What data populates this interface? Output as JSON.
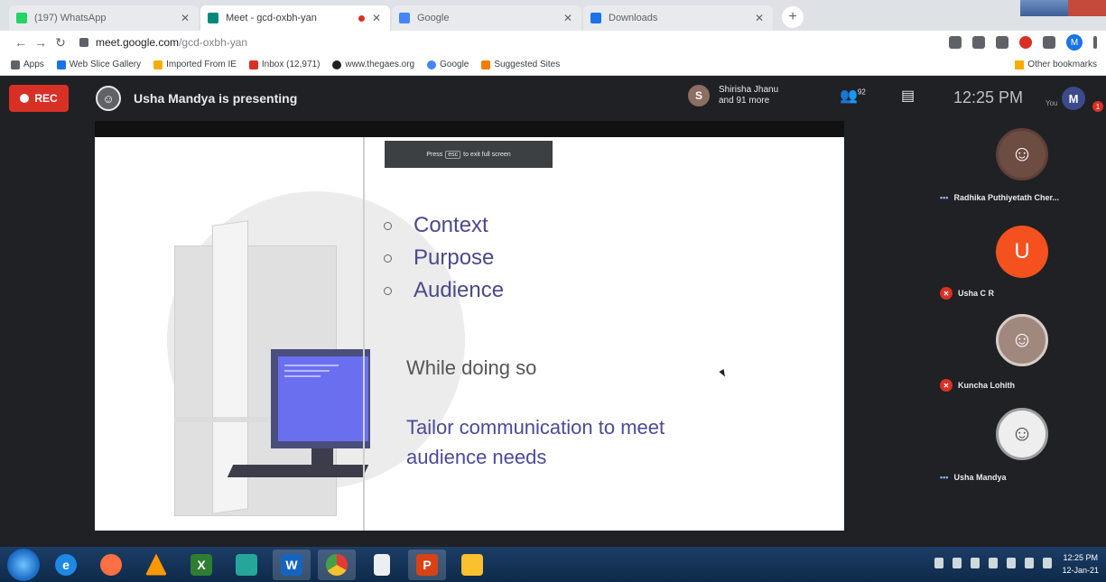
{
  "browser": {
    "tabs": [
      {
        "label": "(197) WhatsApp",
        "color": "#25d366",
        "active": false
      },
      {
        "label": "Meet - gcd-oxbh-yan",
        "color": "#00897b",
        "active": true
      },
      {
        "label": "Google",
        "color": "#4285f4",
        "active": false
      },
      {
        "label": "Downloads",
        "color": "#1a73e8",
        "active": false
      }
    ],
    "url_host": "meet.google.com",
    "url_path": "/gcd-oxbh-yan",
    "bookmarks": [
      {
        "label": "Apps",
        "color": "#5f6368"
      },
      {
        "label": "Web Slice Gallery",
        "color": "#1a73e8"
      },
      {
        "label": "Imported From IE",
        "color": "#f9ab00"
      },
      {
        "label": "Inbox (12,971)",
        "color": "#d93025"
      },
      {
        "label": "www.thegaes.org",
        "color": "#202124"
      },
      {
        "label": "Google",
        "color": "#4285f4"
      },
      {
        "label": "Suggested Sites",
        "color": "#f57c00"
      }
    ],
    "other_bookmarks": "Other bookmarks"
  },
  "meet": {
    "rec_label": "REC",
    "presenter_text": "Usha Mandya is presenting",
    "participant_initial": "S",
    "participant_line1": "Shirisha Jhanu",
    "participant_line2": "and 91 more",
    "people_count": "92",
    "time": "12:25 PM",
    "me_initial": "M",
    "me_sub": "You",
    "badge": "1",
    "esc_press": "Press",
    "esc_key": "esc",
    "esc_rest": "to exit full screen"
  },
  "slide": {
    "bullets": [
      "Context",
      "Purpose",
      "Audience"
    ],
    "line1": "While doing so",
    "line2": "Tailor communication to meet audience needs"
  },
  "participants": [
    {
      "name": "Radhika Puthiyetath Cher...",
      "initial": "",
      "color": "#6d4c41",
      "muted": false
    },
    {
      "name": "Usha C R",
      "initial": "U",
      "color": "#f4511e",
      "muted": true
    },
    {
      "name": "Kuncha Lohith",
      "initial": "",
      "color": "#a1887f",
      "muted": true
    },
    {
      "name": "Usha Mandya",
      "initial": "",
      "color": "#9e9e9e",
      "muted": false
    }
  ],
  "taskbar": {
    "apps": [
      {
        "icon": "ie-icon",
        "glyph": "e",
        "color": "#1e88e5"
      },
      {
        "icon": "firefox-icon",
        "glyph": "",
        "color": "#ff7043"
      },
      {
        "icon": "vlc-icon",
        "glyph": "",
        "color": "#ff9800"
      },
      {
        "icon": "excel-icon",
        "glyph": "X",
        "color": "#2e7d32"
      },
      {
        "icon": "media-icon",
        "glyph": "",
        "color": "#26a69a"
      },
      {
        "icon": "word-icon",
        "glyph": "W",
        "color": "#1565c0"
      },
      {
        "icon": "chrome-icon",
        "glyph": "",
        "color": "#e53935"
      },
      {
        "icon": "document-icon",
        "glyph": "",
        "color": "#eceff1"
      },
      {
        "icon": "powerpoint-icon",
        "glyph": "P",
        "color": "#d84315"
      },
      {
        "icon": "explorer-icon",
        "glyph": "",
        "color": "#fbc02d"
      }
    ],
    "time": "12:25 PM",
    "date": "12-Jan-21"
  }
}
